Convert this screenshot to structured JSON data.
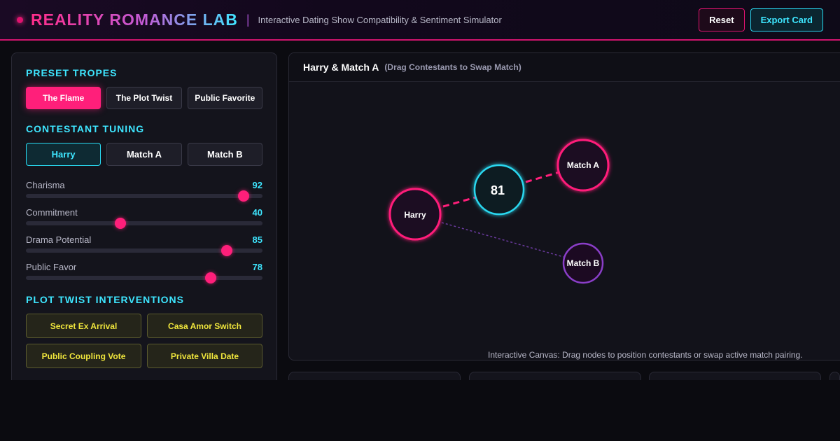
{
  "header": {
    "brand": "REALITY ROMANCE LAB",
    "separator": "|",
    "tagline": "Interactive Dating Show Compatibility & Sentiment Simulator",
    "reset_label": "Reset",
    "export_label": "Export Card"
  },
  "presets": {
    "title": "PRESET TROPES",
    "items": [
      "The Flame",
      "The Plot Twist",
      "Public Favorite"
    ],
    "active": "The Flame"
  },
  "tuning": {
    "title": "CONTESTANT TUNING",
    "tabs": [
      "Harry",
      "Match A",
      "Match B"
    ],
    "active": "Harry",
    "sliders": [
      {
        "label": "Charisma",
        "value": 92
      },
      {
        "label": "Commitment",
        "value": 40
      },
      {
        "label": "Drama Potential",
        "value": 85
      },
      {
        "label": "Public Favor",
        "value": 78
      }
    ]
  },
  "interventions": {
    "title": "PLOT TWIST INTERVENTIONS",
    "items": [
      "Secret Ex Arrival",
      "Casa Amor Switch",
      "Public Coupling Vote",
      "Private Villa Date"
    ]
  },
  "canvas": {
    "title": "Harry & Match A",
    "hint": "(Drag Contestants to Swap Match)",
    "footer": "Interactive Canvas: Drag nodes to position contestants or swap active match pairing.",
    "nodes": {
      "harry": "Harry",
      "score": "81",
      "match_a": "Match A",
      "match_b": "Match B"
    }
  },
  "colors": {
    "accent_pink": "#ff1f7a",
    "accent_cyan": "#3ee6ff",
    "accent_purple": "#8a3ec8",
    "twist_yellow": "#f0e63c"
  }
}
